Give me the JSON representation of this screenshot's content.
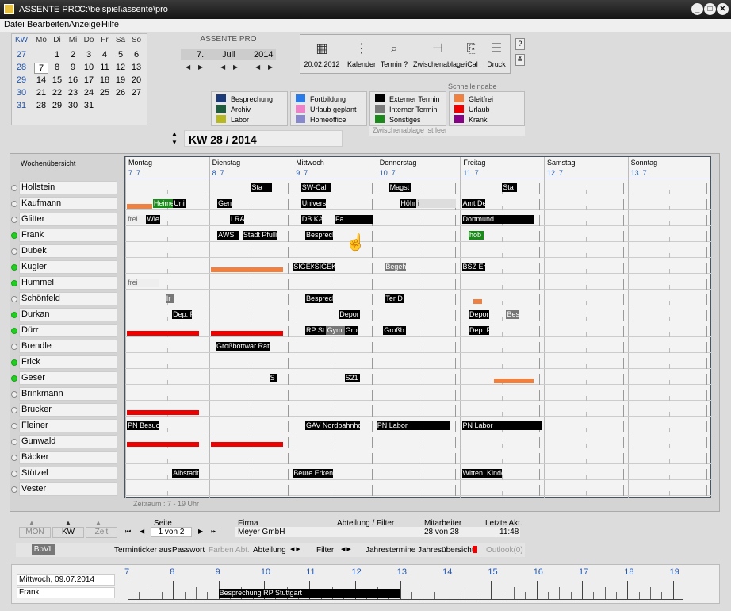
{
  "window": {
    "app": "ASSENTE PRO",
    "path": "C:\\beispiel\\assente\\pro",
    "min": "_",
    "max": "□",
    "close": "✕"
  },
  "menu": [
    "Datei",
    "Bearbeiten",
    "Anzeige",
    "Hilfe"
  ],
  "calendar": {
    "kw_header": "KW",
    "weekdays": [
      "Mo",
      "Di",
      "Mi",
      "Do",
      "Fr",
      "Sa",
      "So"
    ],
    "kw": [
      "27",
      "28",
      "29",
      "30",
      "31"
    ],
    "weeks": [
      [
        "",
        "1",
        "2",
        "3",
        "4",
        "5",
        "6"
      ],
      [
        "7",
        "8",
        "9",
        "10",
        "11",
        "12",
        "13"
      ],
      [
        "14",
        "15",
        "16",
        "17",
        "18",
        "19",
        "20"
      ],
      [
        "21",
        "22",
        "23",
        "24",
        "25",
        "26",
        "27"
      ],
      [
        "28",
        "29",
        "30",
        "31",
        "",
        "",
        ""
      ]
    ],
    "selected": "7"
  },
  "datenav": {
    "label": "ASSENTE PRO",
    "day": "7.",
    "month": "Juli",
    "year": "2014"
  },
  "toolbar": [
    {
      "icon": "grid-icon",
      "label": "20.02.2012"
    },
    {
      "icon": "calendar-icon",
      "label": "Kalender"
    },
    {
      "icon": "search-icon",
      "label": "Termin ?"
    },
    {
      "icon": "clipboard-icon",
      "label": "Zwischenablage"
    },
    {
      "icon": "ical-icon",
      "label": "iCal"
    },
    {
      "icon": "print-icon",
      "label": "Druck"
    }
  ],
  "help": "?",
  "legend": {
    "schnell_label": "Schnelleingabe",
    "clip_status": "Zwischenablage ist leer",
    "col1": [
      {
        "label": "Besprechung",
        "color": "#1a3a7a"
      },
      {
        "label": "Archiv",
        "color": "#1e5e3e"
      },
      {
        "label": "Labor",
        "color": "#b8b820"
      }
    ],
    "col2": [
      {
        "label": "Fortbildung",
        "color": "#2a7ae8"
      },
      {
        "label": "Urlaub geplant",
        "color": "#ee82c8"
      },
      {
        "label": "Homeoffice",
        "color": "#8888cc"
      }
    ],
    "col3": [
      {
        "label": "Externer Termin",
        "color": "#000000"
      },
      {
        "label": "Interner Termin",
        "color": "#7a7a7a"
      },
      {
        "label": "Sonstiges",
        "color": "#1a8a1a"
      }
    ],
    "col4": [
      {
        "label": "Gleitfrei",
        "color": "#f08040"
      },
      {
        "label": "Urlaub",
        "color": "#ee0000"
      },
      {
        "label": "Krank",
        "color": "#880088"
      }
    ]
  },
  "week": {
    "label": "KW 28 / 2014",
    "overview": "Wochenübersicht",
    "range": "Zeitraum : 7 - 19 Uhr",
    "days": [
      {
        "name": "Montag",
        "date": "7. 7."
      },
      {
        "name": "Dienstag",
        "date": "8. 7."
      },
      {
        "name": "Mittwoch",
        "date": "9. 7."
      },
      {
        "name": "Donnerstag",
        "date": "10. 7."
      },
      {
        "name": "Freitag",
        "date": "11. 7."
      },
      {
        "name": "Samstag",
        "date": "12. 7."
      },
      {
        "name": "Sonntag",
        "date": "13. 7."
      }
    ]
  },
  "people": [
    {
      "name": "Hollstein",
      "on": false
    },
    {
      "name": "Kaufmann",
      "on": false
    },
    {
      "name": "Glitter",
      "on": false
    },
    {
      "name": "Frank",
      "on": true
    },
    {
      "name": "Dubek",
      "on": false
    },
    {
      "name": "Kugler",
      "on": true
    },
    {
      "name": "Hummel",
      "on": true
    },
    {
      "name": "Schönfeld",
      "on": false
    },
    {
      "name": "Durkan",
      "on": true
    },
    {
      "name": "Dürr",
      "on": true
    },
    {
      "name": "Brendle",
      "on": false
    },
    {
      "name": "Frick",
      "on": true
    },
    {
      "name": "Geser",
      "on": true
    },
    {
      "name": "Brinkmann",
      "on": false
    },
    {
      "name": "Brucker",
      "on": false
    },
    {
      "name": "Fleiner",
      "on": false
    },
    {
      "name": "Gunwald",
      "on": false
    },
    {
      "name": "Bäcker",
      "on": false
    },
    {
      "name": "Stützel",
      "on": false
    },
    {
      "name": "Vester",
      "on": false
    }
  ],
  "events": [
    {
      "row": 0,
      "day": 1,
      "s": 0.5,
      "e": 0.75,
      "t": "Sta",
      "c": "#000"
    },
    {
      "row": 0,
      "day": 2,
      "s": 0.1,
      "e": 0.45,
      "t": "SW-Cal",
      "c": "#000"
    },
    {
      "row": 0,
      "day": 3,
      "s": 0.15,
      "e": 0.42,
      "t": "Magst",
      "c": "#000"
    },
    {
      "row": 0,
      "day": 4,
      "s": 0.5,
      "e": 0.68,
      "t": "Sta",
      "c": "#000"
    },
    {
      "row": 1,
      "day": 0,
      "s": 0.33,
      "e": 0.58,
      "t": "Heime",
      "c": "#1a8a1a"
    },
    {
      "row": 1,
      "day": 0,
      "s": 0.57,
      "e": 0.73,
      "t": "Uni",
      "c": "#000"
    },
    {
      "row": 1,
      "day": 1,
      "s": 0.1,
      "e": 0.28,
      "t": "Gen",
      "c": "#000"
    },
    {
      "row": 1,
      "day": 2,
      "s": 0.1,
      "e": 0.4,
      "t": "Univers",
      "c": "#000"
    },
    {
      "row": 1,
      "day": 3,
      "s": 0.28,
      "e": 0.5,
      "t": "Höhne",
      "c": "#000"
    },
    {
      "row": 1,
      "day": 3,
      "s": 0.48,
      "e": 0.95,
      "t": "i",
      "c": "#ddd",
      "fg": "#555"
    },
    {
      "row": 1,
      "day": 4,
      "s": 0.02,
      "e": 0.3,
      "t": "Amt De",
      "c": "#000"
    },
    {
      "row": 2,
      "day": 0,
      "s": 0.02,
      "e": 0.25,
      "t": "frei",
      "c": "#eee",
      "fg": "#666"
    },
    {
      "row": 2,
      "day": 0,
      "s": 0.25,
      "e": 0.42,
      "t": "Wie",
      "c": "#000"
    },
    {
      "row": 2,
      "day": 1,
      "s": 0.25,
      "e": 0.42,
      "t": "LRA",
      "c": "#000"
    },
    {
      "row": 2,
      "day": 2,
      "s": 0.1,
      "e": 0.35,
      "t": "DB KA",
      "c": "#000"
    },
    {
      "row": 2,
      "day": 2,
      "s": 0.5,
      "e": 0.95,
      "t": "Fa",
      "c": "#000"
    },
    {
      "row": 2,
      "day": 4,
      "s": 0.02,
      "e": 0.88,
      "t": "Dortmund",
      "c": "#000"
    },
    {
      "row": 3,
      "day": 1,
      "s": 0.1,
      "e": 0.35,
      "t": "AWS",
      "c": "#000"
    },
    {
      "row": 3,
      "day": 1,
      "s": 0.4,
      "e": 0.82,
      "t": "Stadt Pfullir",
      "c": "#000"
    },
    {
      "row": 3,
      "day": 2,
      "s": 0.15,
      "e": 0.48,
      "t": "Besprech",
      "c": "#000"
    },
    {
      "row": 3,
      "day": 4,
      "s": 0.1,
      "e": 0.28,
      "t": "hob",
      "c": "#1a8a1a"
    },
    {
      "row": 5,
      "day": 2,
      "s": 0.0,
      "e": 0.25,
      "t": "SIGEK",
      "c": "#000"
    },
    {
      "row": 5,
      "day": 2,
      "s": 0.25,
      "e": 0.5,
      "t": "SIGEK",
      "c": "#000"
    },
    {
      "row": 5,
      "day": 3,
      "s": 0.1,
      "e": 0.35,
      "t": "Begeh",
      "c": "#777"
    },
    {
      "row": 5,
      "day": 4,
      "s": 0.02,
      "e": 0.3,
      "t": "BSZ Er",
      "c": "#000"
    },
    {
      "row": 6,
      "day": 0,
      "s": 0.02,
      "e": 0.4,
      "t": "frei",
      "c": "#eee",
      "fg": "#666"
    },
    {
      "row": 7,
      "day": 0,
      "s": 0.48,
      "e": 0.58,
      "t": "Ir",
      "c": "#777"
    },
    {
      "row": 7,
      "day": 2,
      "s": 0.15,
      "e": 0.48,
      "t": "Besprech",
      "c": "#000"
    },
    {
      "row": 7,
      "day": 3,
      "s": 0.1,
      "e": 0.33,
      "t": "Ter D",
      "c": "#000"
    },
    {
      "row": 8,
      "day": 0,
      "s": 0.56,
      "e": 0.8,
      "t": "Dep. F",
      "c": "#000"
    },
    {
      "row": 8,
      "day": 2,
      "s": 0.55,
      "e": 0.8,
      "t": "Depor",
      "c": "#000"
    },
    {
      "row": 8,
      "day": 4,
      "s": 0.1,
      "e": 0.35,
      "t": "Depor",
      "c": "#000"
    },
    {
      "row": 8,
      "day": 4,
      "s": 0.55,
      "e": 0.7,
      "t": "Bes",
      "c": "#777"
    },
    {
      "row": 9,
      "day": 2,
      "s": 0.15,
      "e": 0.4,
      "t": "RP St",
      "c": "#000"
    },
    {
      "row": 9,
      "day": 2,
      "s": 0.4,
      "e": 0.65,
      "t": "Gymn",
      "c": "#777"
    },
    {
      "row": 9,
      "day": 2,
      "s": 0.62,
      "e": 0.78,
      "t": "Gro",
      "c": "#000"
    },
    {
      "row": 9,
      "day": 3,
      "s": 0.08,
      "e": 0.35,
      "t": "Großb",
      "c": "#000"
    },
    {
      "row": 9,
      "day": 4,
      "s": 0.1,
      "e": 0.35,
      "t": "Dep. F",
      "c": "#000"
    },
    {
      "row": 10,
      "day": 1,
      "s": 0.08,
      "e": 0.72,
      "t": "Großbottwar Rath",
      "c": "#000"
    },
    {
      "row": 12,
      "day": 1,
      "s": 0.72,
      "e": 0.82,
      "t": "S",
      "c": "#000"
    },
    {
      "row": 12,
      "day": 2,
      "s": 0.62,
      "e": 0.8,
      "t": "S21",
      "c": "#000"
    },
    {
      "row": 15,
      "day": 0,
      "s": 0.02,
      "e": 0.4,
      "t": "PN Besuc",
      "c": "#000"
    },
    {
      "row": 15,
      "day": 2,
      "s": 0.15,
      "e": 0.8,
      "t": "GAV Nordbahnho",
      "c": "#000"
    },
    {
      "row": 15,
      "day": 3,
      "s": 0.0,
      "e": 0.88,
      "t": "PN Labor",
      "c": "#000"
    },
    {
      "row": 15,
      "day": 4,
      "s": 0.02,
      "e": 0.97,
      "t": "PN Labor",
      "c": "#000"
    },
    {
      "row": 16,
      "day": 3,
      "s": 0,
      "e": 0,
      "t": "",
      "c": "#000"
    },
    {
      "row": 18,
      "day": 0,
      "s": 0.56,
      "e": 0.88,
      "t": "Albstadt",
      "c": "#000"
    },
    {
      "row": 18,
      "day": 2,
      "s": 0.0,
      "e": 0.25,
      "t": "Beure",
      "c": "#000"
    },
    {
      "row": 18,
      "day": 2,
      "s": 0.25,
      "e": 0.48,
      "t": "Erkent",
      "c": "#000"
    },
    {
      "row": 18,
      "day": 4,
      "s": 0.02,
      "e": 0.5,
      "t": "Witten, Kinde",
      "c": "#000"
    }
  ],
  "bars": [
    {
      "row": 1,
      "day": 0,
      "s": 0.02,
      "e": 0.32,
      "c": "#f08040"
    },
    {
      "row": 5,
      "day": 1,
      "s": 0.02,
      "e": 0.88,
      "c": "#f08040"
    },
    {
      "row": 7,
      "day": 4,
      "s": 0.16,
      "e": 0.26,
      "c": "#f08040"
    },
    {
      "row": 9,
      "day": 0,
      "s": 0.02,
      "e": 0.88,
      "c": "#ee0000"
    },
    {
      "row": 9,
      "day": 1,
      "s": 0.02,
      "e": 0.88,
      "c": "#ee0000"
    },
    {
      "row": 12,
      "day": 4,
      "s": 0.4,
      "e": 0.88,
      "c": "#f08040"
    },
    {
      "row": 14,
      "day": 0,
      "s": 0.02,
      "e": 0.88,
      "c": "#ee0000"
    },
    {
      "row": 16,
      "day": 0,
      "s": 0.02,
      "e": 0.88,
      "c": "#ee0000"
    },
    {
      "row": 16,
      "day": 1,
      "s": 0.02,
      "e": 0.88,
      "c": "#ee0000"
    }
  ],
  "bottom": {
    "views": [
      "MON",
      "KW",
      "Zeit"
    ],
    "seite_label": "Seite",
    "seite_val": "1 von 2",
    "firma_label": "Firma",
    "firma_val": "Meyer GmbH",
    "abt_label": "Abteilung / Filter",
    "mit_label": "Mitarbeiter",
    "mit_val": "28 von 28",
    "akt_label": "Letzte Akt.",
    "akt_val": "11:48"
  },
  "bottom2": {
    "bpvl": "BpVL",
    "items": [
      "Terminticker aus",
      "Passwort",
      "Farben Abt.",
      "Abteilung",
      "Filter",
      "Jahrestermine",
      "Jahresübersicht",
      "Outlook(0)"
    ]
  },
  "timeline": {
    "date": "Mittwoch, 09.07.2014",
    "person": "Frank",
    "hours": [
      "7",
      "8",
      "9",
      "10",
      "11",
      "12",
      "13",
      "14",
      "15",
      "16",
      "17",
      "18",
      "19"
    ],
    "event": "Besprechung RP Stuttgart",
    "ev_start": 9,
    "ev_end": 13
  }
}
